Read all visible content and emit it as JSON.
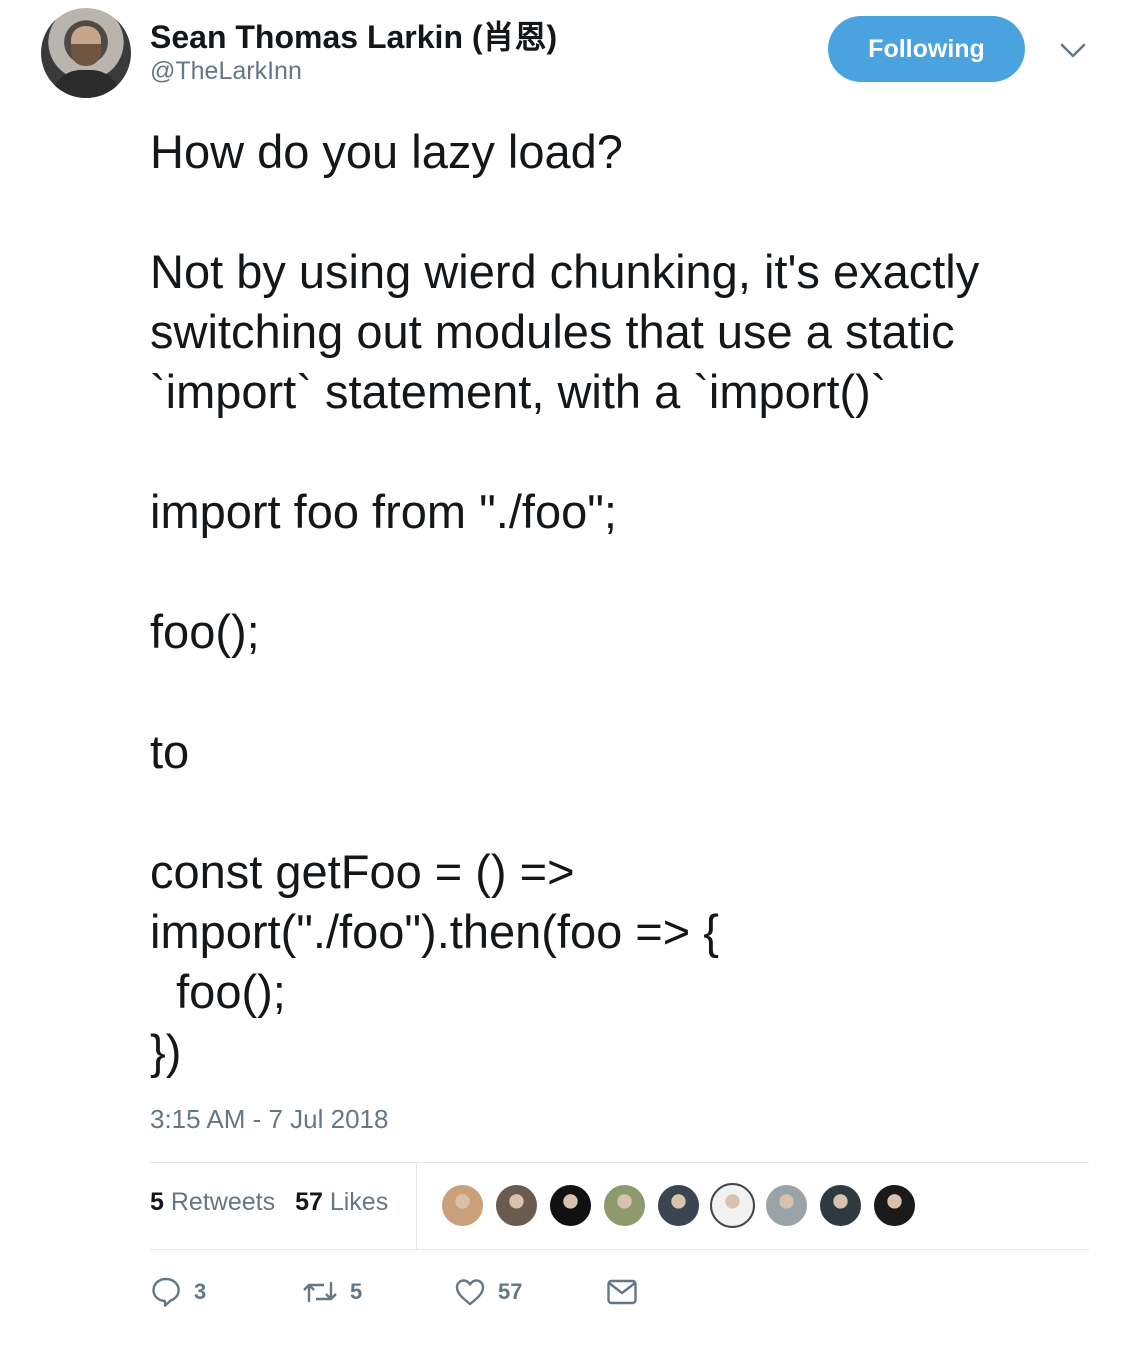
{
  "author": {
    "display_name": "Sean Thomas Larkin (肖恩)",
    "handle": "@TheLarkInn"
  },
  "follow_button": {
    "label": "Following"
  },
  "tweet": {
    "text": "How do you lazy load?\n\nNot by using wierd chunking, it's exactly switching out modules that use a static `import` statement, with a `import()`\n\nimport foo from \"./foo\";\n\nfoo();\n\nto\n\nconst getFoo = () =>\nimport(\"./foo\").then(foo => {\n  foo();\n})",
    "timestamp": "3:15 AM - 7 Jul 2018"
  },
  "stats": {
    "retweets_count": "5",
    "retweets_label": "Retweets",
    "likes_count": "57",
    "likes_label": "Likes"
  },
  "likers": [
    {
      "color": "#c9a07a"
    },
    {
      "color": "#6b5a4e"
    },
    {
      "color": "#111111"
    },
    {
      "color": "#8c9a6e"
    },
    {
      "color": "#3b4552"
    },
    {
      "color": "#f2f2f2"
    },
    {
      "color": "#9aa3a8"
    },
    {
      "color": "#2e3a3f"
    },
    {
      "color": "#1a1a1a"
    }
  ],
  "actions": {
    "reply_count": "3",
    "retweet_count": "5",
    "like_count": "57"
  },
  "colors": {
    "accent": "#4aa3df",
    "secondary_text": "#657786",
    "divider": "#e1e8ed"
  }
}
